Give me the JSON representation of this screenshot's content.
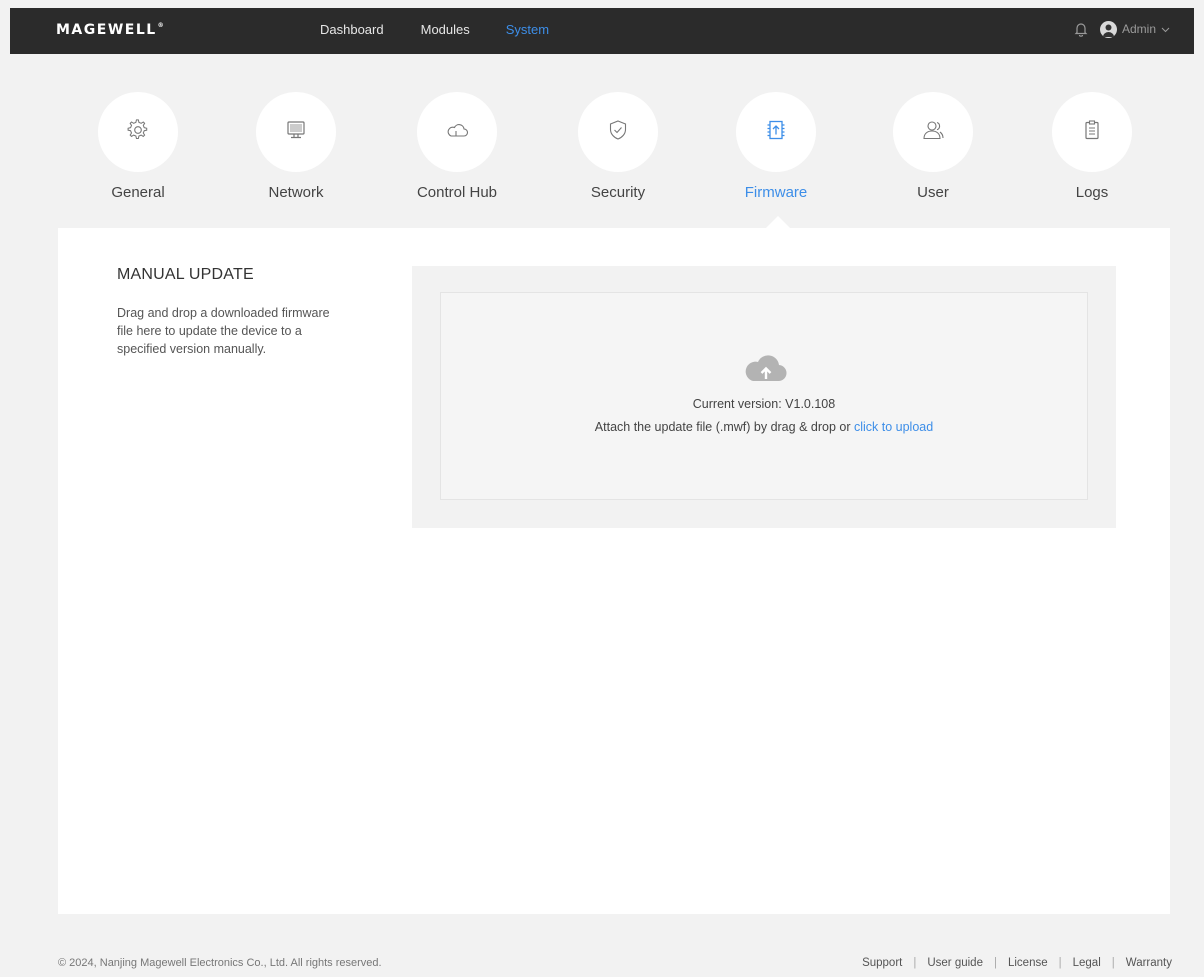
{
  "header": {
    "logo": "MAGEWELL",
    "logo_mark": "®",
    "nav": [
      {
        "label": "Dashboard"
      },
      {
        "label": "Modules"
      },
      {
        "label": "System"
      }
    ],
    "active_nav": "System",
    "user_label": "Admin",
    "accent_color": "#3d8ee8"
  },
  "categories": [
    {
      "label": "General",
      "icon": "gear-icon"
    },
    {
      "label": "Network",
      "icon": "monitor-icon"
    },
    {
      "label": "Control Hub",
      "icon": "cloud-icon"
    },
    {
      "label": "Security",
      "icon": "shield-icon"
    },
    {
      "label": "Firmware",
      "icon": "firmware-icon"
    },
    {
      "label": "User",
      "icon": "users-icon"
    },
    {
      "label": "Logs",
      "icon": "clipboard-icon"
    }
  ],
  "active_category": "Firmware",
  "main": {
    "title": "MANUAL UPDATE",
    "description": "Drag and drop a downloaded firmware file here to update the device to a specified version manually.",
    "current_version": "Current version: V1.0.108",
    "attach_text": "Attach the update file (.mwf) by drag & drop or",
    "upload_link": "click to upload"
  },
  "footer": {
    "copyright": "© 2024, Nanjing Magewell Electronics Co., Ltd. All rights reserved.",
    "links": [
      {
        "label": "Support"
      },
      {
        "label": "User guide"
      },
      {
        "label": "License"
      },
      {
        "label": "Legal"
      },
      {
        "label": "Warranty"
      }
    ]
  }
}
